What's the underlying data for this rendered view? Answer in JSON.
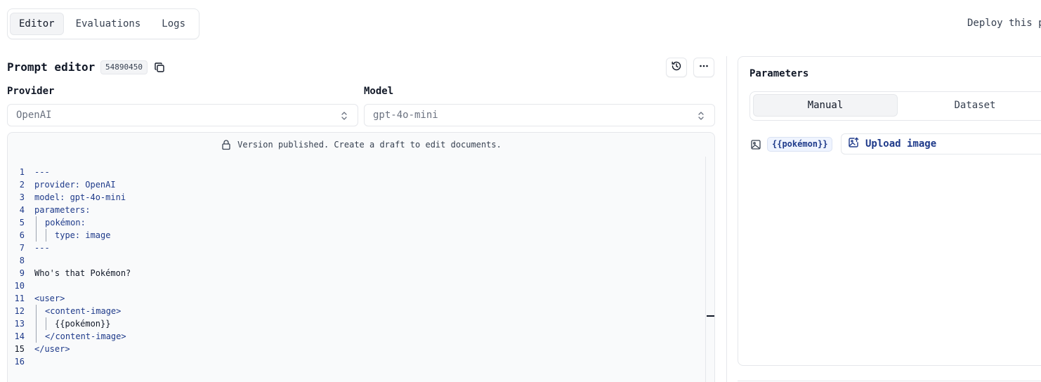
{
  "tabs": [
    {
      "label": "Editor",
      "active": true
    },
    {
      "label": "Evaluations",
      "active": false
    },
    {
      "label": "Logs",
      "active": false
    }
  ],
  "header_right": {
    "deploy_text": "Deploy this p"
  },
  "prompt_editor": {
    "title": "Prompt editor",
    "id_badge": "54890450",
    "icons": {
      "copy": "copy-icon",
      "history": "history-icon",
      "more": "more-horizontal-icon"
    }
  },
  "provider": {
    "label": "Provider",
    "value": "OpenAI"
  },
  "model": {
    "label": "Model",
    "value": "gpt-4o-mini"
  },
  "editor": {
    "banner": "Version published. Create a draft to edit documents.",
    "current_line": 15,
    "lines": [
      {
        "n": "1",
        "text": "---"
      },
      {
        "n": "2",
        "text": "provider: OpenAI"
      },
      {
        "n": "3",
        "text": "model: gpt-4o-mini"
      },
      {
        "n": "4",
        "text": "parameters:"
      },
      {
        "n": "5",
        "text": "pokémon:"
      },
      {
        "n": "6",
        "text": "type: image"
      },
      {
        "n": "7",
        "text": "---"
      },
      {
        "n": "8",
        "text": ""
      },
      {
        "n": "9",
        "text": "Who's that Pokémon?"
      },
      {
        "n": "10",
        "text": ""
      },
      {
        "n": "11",
        "text": "<user>"
      },
      {
        "n": "12",
        "text": "<content-image>"
      },
      {
        "n": "13",
        "text": "{{pokémon}}"
      },
      {
        "n": "14",
        "text": "</content-image>"
      },
      {
        "n": "15",
        "text": "</user>"
      },
      {
        "n": "16",
        "text": ""
      }
    ]
  },
  "parameters": {
    "title": "Parameters",
    "modes": [
      {
        "label": "Manual",
        "active": true
      },
      {
        "label": "Dataset",
        "active": false
      }
    ],
    "items": [
      {
        "badge": "{{pokémon}}",
        "action": "Upload image",
        "type_icon": "image-icon",
        "action_icon": "image-upload-icon"
      }
    ]
  },
  "colors": {
    "accent": "#1e3a8a",
    "border": "#e5e7eb",
    "editor_bg": "#f9fafb"
  }
}
